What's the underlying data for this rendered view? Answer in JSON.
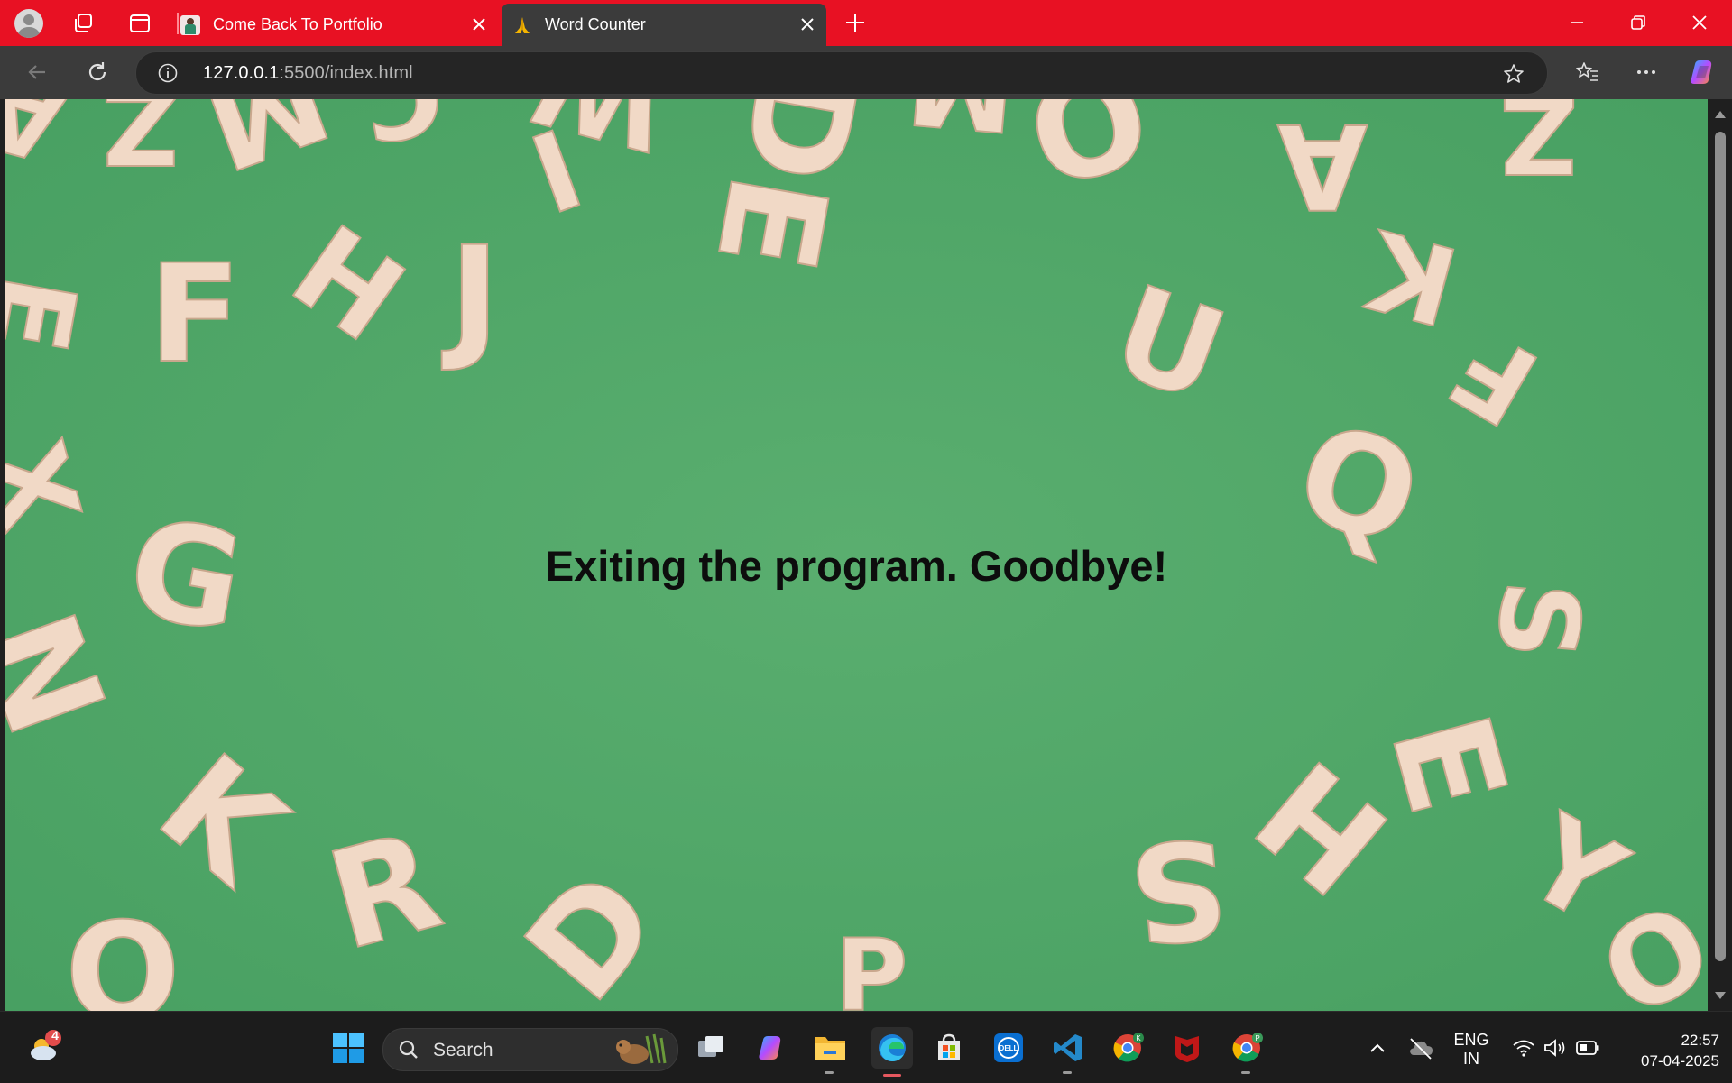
{
  "browser": {
    "tabs": [
      {
        "title": "Come Back To Portfolio",
        "active": false
      },
      {
        "title": "Word Counter",
        "active": true
      }
    ],
    "address": {
      "host": "127.0.0.1",
      "path": ":5500/index.html"
    },
    "theme_color": "#e81123"
  },
  "page": {
    "message": "Exiting the program. Goodbye!",
    "background_color": "#4ea868",
    "letters": [
      "A",
      "Z",
      "M",
      "C",
      "W",
      "D",
      "M",
      "O",
      "A",
      "Z",
      "E",
      "F",
      "H",
      "J",
      "I",
      "E",
      "U",
      "K",
      "F",
      "X",
      "Q",
      "G",
      "S",
      "N",
      "E",
      "K",
      "R",
      "D",
      "S",
      "H",
      "Y",
      "O",
      "P",
      "O"
    ]
  },
  "taskbar": {
    "weather_badge": "4",
    "search_label": "Search",
    "icons": [
      "weather-icon",
      "start-icon",
      "search-icon",
      "task-view-icon",
      "copilot-icon",
      "file-explorer-icon",
      "edge-icon",
      "store-icon",
      "dell-icon",
      "vscode-icon",
      "chrome-icon",
      "mcafee-icon",
      "chrome-profile-icon"
    ],
    "language": "ENG",
    "region": "IN",
    "time": "22:57",
    "date": "07-04-2025"
  }
}
